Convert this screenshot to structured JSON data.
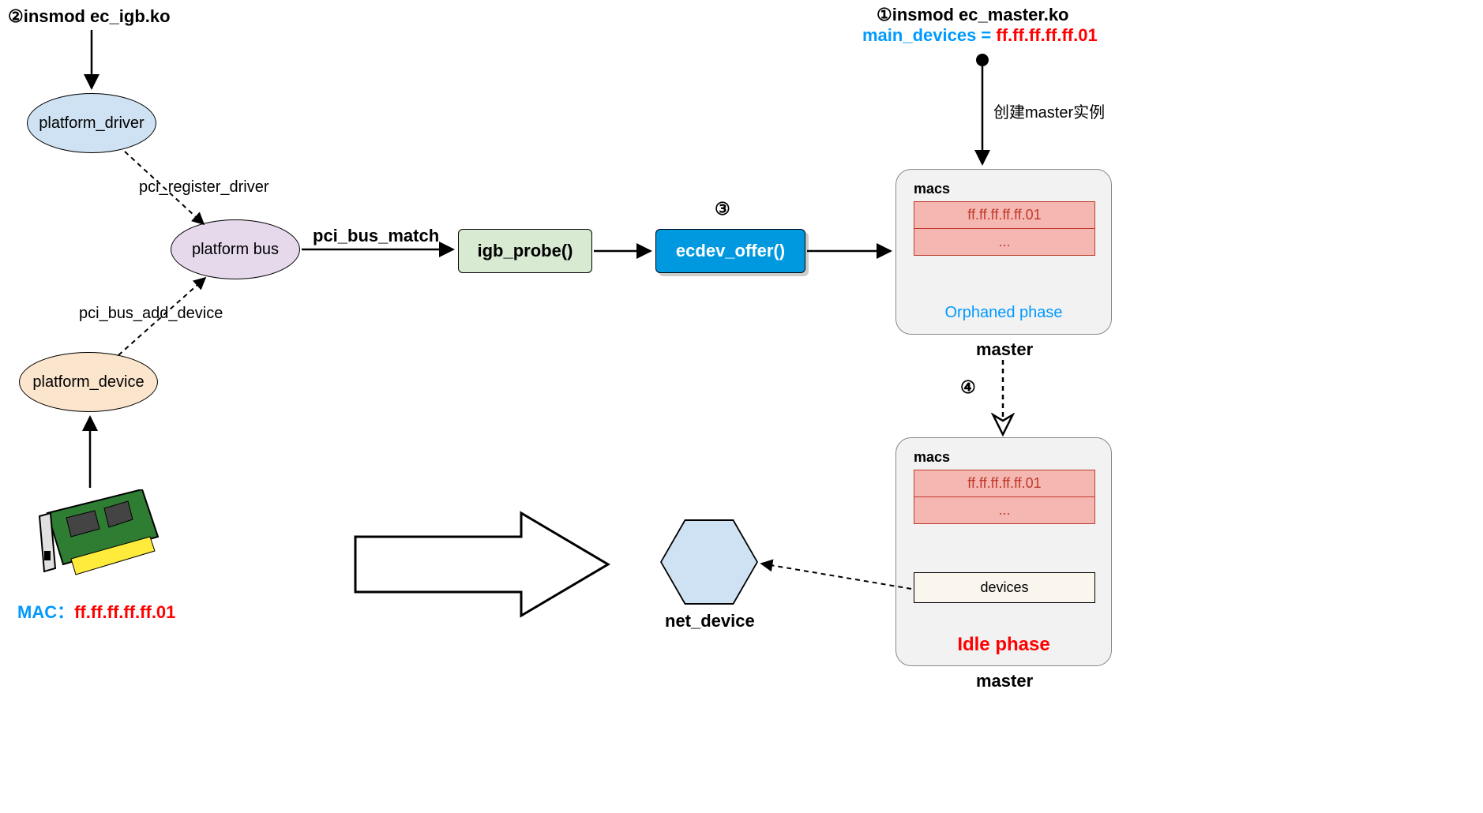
{
  "step2_label": "②insmod ec_igb.ko",
  "platform_driver": "platform_driver",
  "pci_register_driver": "pci_register_driver",
  "platform_bus": "platform bus",
  "pci_bus_match": "pci_bus_match",
  "igb_probe": "igb_probe()",
  "ecdev_offer": "ecdev_offer()",
  "step3_num": "③",
  "pci_bus_add_device": "pci_bus_add_device",
  "platform_device": "platform_device",
  "mac_label_prefix": "MAC：",
  "mac_value": "ff.ff.ff.ff.ff.01",
  "step1_line1": "①insmod ec_master.ko",
  "step1_line2a": "main_devices = ",
  "step1_line2b": "ff.ff.ff.ff.ff.01",
  "create_master_instance": "创建master实例",
  "master1": {
    "macs_title": "macs",
    "row1": "ff.ff.ff.ff.ff.01",
    "row2": "...",
    "phase": "Orphaned phase",
    "caption": "master"
  },
  "step4_num": "④",
  "master2": {
    "macs_title": "macs",
    "row1": "ff.ff.ff.ff.ff.01",
    "row2": "...",
    "devices": "devices",
    "phase": "Idle phase",
    "caption": "master"
  },
  "net_device_lbl": "net_device"
}
